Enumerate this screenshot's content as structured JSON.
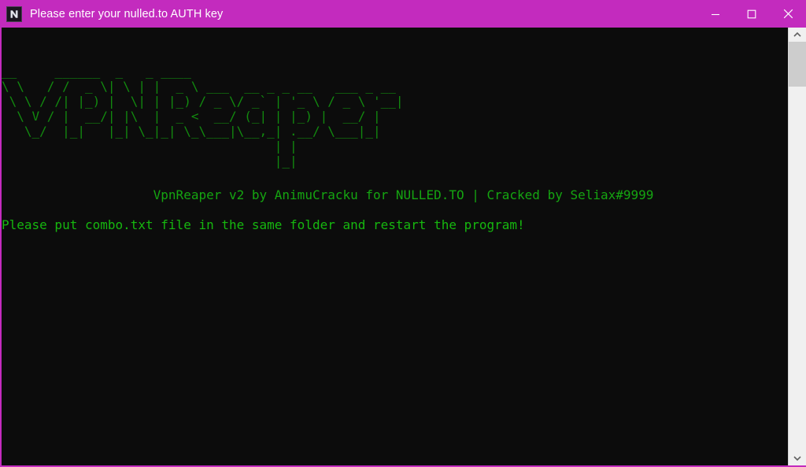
{
  "window": {
    "title": "Please enter your nulled.to AUTH key",
    "icon_name": "nulled-to-logo-icon",
    "titlebar_color": "#c32bbe",
    "border_color": "#c32bbe",
    "console_background": "#0c0c0c",
    "console_text_color": "#13a10e"
  },
  "window_controls": [
    {
      "name": "minimize-button",
      "glyph": "minimize"
    },
    {
      "name": "maximize-button",
      "glyph": "maximize"
    },
    {
      "name": "close-button",
      "glyph": "close"
    }
  ],
  "console": {
    "ascii_banner": "__     ______  _   _ ____\n\\ \\   / /  _ \\| \\ | |  _ \\ ___  __ _ _ __   ___ _ __\n \\ \\ / /| |_) |  \\| | |_) / _ \\/ _` | '_ \\ / _ \\ '__|\n  \\ V / |  __/| |\\  |  _ <  __/ (_| | |_) |  __/ |\n   \\_/  |_|   |_| \\_|_| \\_\\___|\\__,_| .__/ \\___|_|\n                                    | |\n                                    |_|",
    "credits_line": "                    VpnReaper v2 by AnimuCracku for NULLED.TO | Cracked by Seliax#9999",
    "status_line": "Please put combo.txt file in the same folder and restart the program!"
  },
  "scrollbar": {
    "up_arrow_name": "scroll-up-button",
    "down_arrow_name": "scroll-down-button",
    "thumb_name": "scrollbar-thumb",
    "track_color": "#f0f0f0",
    "thumb_color": "#cdcdcd"
  }
}
